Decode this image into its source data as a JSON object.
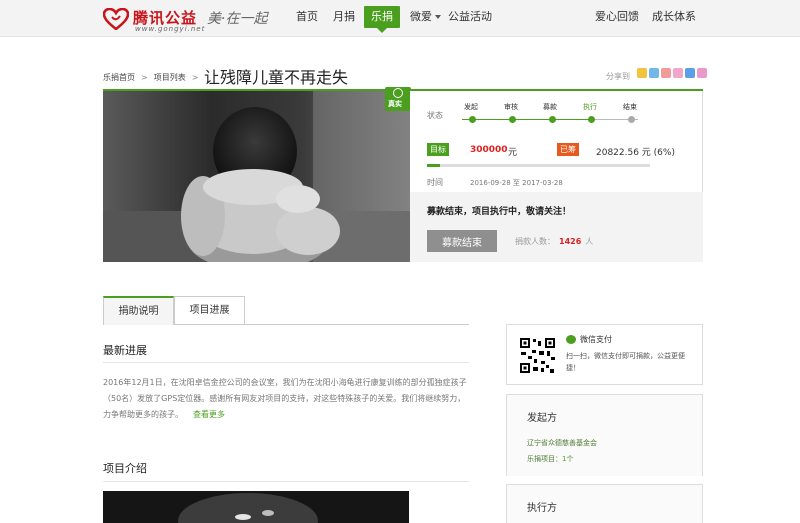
{
  "header": {
    "logo_text": "腾讯公益",
    "logo_sub": "www.gongyi.net",
    "slogan": "美·在一起",
    "nav": [
      {
        "label": "首页"
      },
      {
        "label": "月捐"
      },
      {
        "label": "乐捐"
      },
      {
        "label": "微爱"
      },
      {
        "label": "公益活动"
      },
      {
        "label": "爱心回馈"
      },
      {
        "label": "成长体系"
      }
    ]
  },
  "breadcrumb": {
    "items": [
      "乐捐首页",
      "项目列表"
    ],
    "separator": ">"
  },
  "project": {
    "title": "让残障儿童不再走失",
    "share_label": "分享到",
    "badge": "真实",
    "status_label": "状态",
    "steps": [
      "发起",
      "审核",
      "募款",
      "执行",
      "结束"
    ],
    "current_step": "执行",
    "goal_label": "目标",
    "goal_value": "300000",
    "goal_unit": "元",
    "raised_label": "已筹",
    "raised_value": "20822.56 元 (6%)",
    "progress_percent": 6,
    "time_label": "时间",
    "time_start": "2016-09-28",
    "time_to": "至",
    "time_end": "2017-03-28",
    "ended_message": "募款结束，项目执行中，敬请关注！",
    "ended_button": "募款结束",
    "donors_label": "捐款人数：",
    "donors_value": "1426",
    "donors_unit": "人"
  },
  "tabs": [
    {
      "label": "捐助说明"
    },
    {
      "label": "项目进展"
    }
  ],
  "latest": {
    "title": "最新进展",
    "text": "2016年12月1日，在沈阳卓信金控公司的会议室，我们为在沈阳小海龟进行康复训练的部分孤独症孩子（50名）发放了GPS定位器。感谢所有网友对项目的支持，对这些特殊孩子的关爱。我们将继续努力，力争帮助更多的孩子。",
    "read_more": "查看更多"
  },
  "intro": {
    "title": "项目介绍"
  },
  "sidebar": {
    "wechat_title": "微信支付",
    "wechat_desc": "扫一扫，微信支付即可捐款，公益更便捷！",
    "initiator_title": "发起方",
    "initiator_name": "辽宁省众德慈善基金会",
    "initiator_projects_label": "乐捐项目：",
    "initiator_projects_count": "1",
    "initiator_projects_unit": "个",
    "executor_title": "执行方"
  },
  "colors": {
    "brand_green": "#4b9f1e",
    "brand_red": "#c9141c",
    "raised_orange": "#e65a20"
  }
}
